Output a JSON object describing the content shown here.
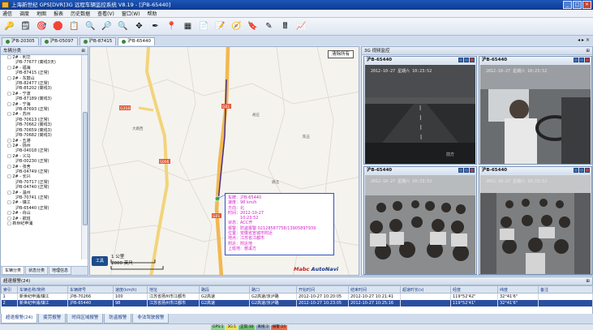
{
  "window": {
    "title": "上海新世纪 GPS[DVR]3G 远程车辆监控系统 V8.19 - [沪B-65440]"
  },
  "menu": [
    "通信",
    "调度",
    "地图",
    "报表",
    "历史数据",
    "查看(V)",
    "窗口(W)",
    "帮助"
  ],
  "toolbar": {
    "icons": [
      "🔑",
      "🗒",
      "🎯",
      "🛑",
      "📋",
      "🔍",
      "🔎",
      "🔍",
      "✥",
      "✒",
      "📍",
      "▦",
      "📄",
      "📝",
      "🧭",
      "🔖",
      "✎",
      "🖩",
      "📈"
    ]
  },
  "vehicle_tabs": [
    "沪B-20305",
    "沪B-05097",
    "沪B-87415",
    "沪B-65440"
  ],
  "left": {
    "header": "车辆分类",
    "tree": [
      "□ 2# - 利华",
      "沪B-77677 (离线3天)",
      "□ 2# - 福海",
      "沪B-87415 (正常)",
      "□ 2# - 东鼓山",
      "沪B-82477 (正常)",
      "沪B-85202 (离线3)",
      "□ 2# - 宁波",
      "沪B-87189 (离线3)",
      "□ 2# - 宁海",
      "沪B-87693 (正常)",
      "□ 2# - 苏州",
      "沪B-70613 (正常)",
      "沪B-70662 (离线3)",
      "沪B-70659 (离线3)",
      "沪B-70682 (离线3)",
      "□ 2# - 五港",
      "□ 2# - 扬州",
      "沪B-04018 (正常)",
      "□ 2# - 义乌",
      "沪B-00230 (正常)",
      "□ 2# - 张舍",
      "沪B-04749 (正常)",
      "□ 2# - 长兴",
      "沪B-70717 (正常)",
      "沪B-04740 (正常)",
      "□ 2# - 温州",
      "沪B-70741 (正常)",
      "□ 2# - 镇江",
      "沪B-65440 (正常)",
      "□ 2# - 舟山",
      "□ 2# - 航班",
      "□ 新世纪申浦"
    ],
    "tabs": [
      "车辆分类",
      "状态分类",
      "地理信息"
    ]
  },
  "map": {
    "clear_label": "清除所有",
    "scale_top": "1 公里",
    "scale_bottom": "2000 英尺",
    "tool": "工具",
    "logo_main": "Mabc",
    "logo_sub": "AutoNavi",
    "road_labels": [
      "G318",
      "S006",
      "G01",
      "G01"
    ],
    "places": [
      "大路西",
      "胡庄",
      "陈庄",
      "跳北"
    ],
    "info": [
      "车牌：沪B-65440",
      "速度：98 km/h",
      "方向：北",
      "时间：2012-10-27",
      "　　　10:23:52",
      "状态：ACC开",
      "报警：防盗报警 02128587758/13905897939",
      "位置：安徽省宣城市附近",
      "地点：江苏省江都市",
      "附近：附近地",
      "上班地：慈溪方"
    ]
  },
  "video": {
    "header": "3G 视频监控",
    "cells": [
      {
        "title": "沪B-65440",
        "ts": "2012-10-27 星期六 10:23:52"
      },
      {
        "title": "沪B-65440",
        "ts": "2012-10-27 星期六 10:23:52"
      },
      {
        "title": "沪B-65440",
        "ts": "2012-10-27 星期六 10:23:52"
      },
      {
        "title": "沪B-65440",
        "ts": "2012-10-27 星期六 10:23:52"
      }
    ],
    "scene_label": "前方"
  },
  "alarm": {
    "header": "超速报警(24)",
    "columns": [
      "索引",
      "车辆名称/简称",
      "车辆牌号",
      "速度(km/h)",
      "地址",
      "路段",
      "路口",
      "开始时间",
      "结束时间",
      "超速时长(s)",
      "经度",
      "纬度",
      "备注"
    ],
    "rows": [
      [
        "1",
        "新世纪申浦/镇江",
        "沪B-70266",
        "100",
        "江苏省扬州市江都市",
        "G2高速",
        "G2高速/京泸路",
        "2012-10-27 10:20:05",
        "2012-10-27 10:21:41",
        "",
        "119°52'42\"",
        "32°41'6\"",
        ""
      ],
      [
        "2",
        "新世纪申浦/镇江",
        "沪B-65440",
        "98",
        "江苏省扬州市江都市",
        "G2高速",
        "G2高速/京泸路",
        "2012-10-27 10:23:05",
        "2012-10-27 10:25:16",
        "",
        "119°52'41\"",
        "32°41'6\"",
        ""
      ]
    ],
    "tabs": [
      "超速报警(24)",
      "疲劳报警",
      "时间区域报警",
      "防盗报警",
      "非法驾驶报警"
    ]
  },
  "status": [
    "GPS:1",
    "3G:1",
    "正常:10",
    "离线:3",
    "报警:24"
  ]
}
